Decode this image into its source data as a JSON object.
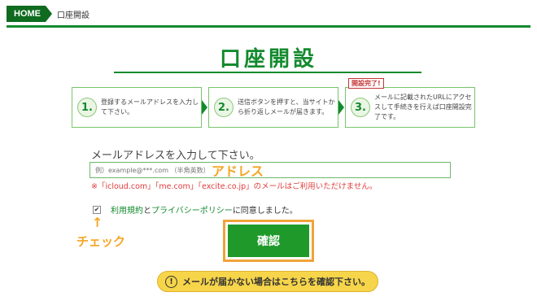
{
  "breadcrumb": {
    "home": "HOME",
    "current": "口座開設"
  },
  "page": {
    "title": "口座開設"
  },
  "steps": [
    {
      "num": "1.",
      "text": "登録するメールアドレスを入力して下さい。"
    },
    {
      "num": "2.",
      "text": "送信ボタンを押すと、当サイトから折り返しメールが届きます。"
    },
    {
      "num": "3.",
      "text": "メールに記載されたURLにアクセスして手続きを行えば口座開設完了です。"
    }
  ],
  "steps_badge": "開設完了!",
  "form": {
    "email_label": "メールアドレスを入力して下さい。",
    "email_placeholder": "例）example@***.com （半角英数）",
    "warning": "※「icloud.com」「me.com」「excite.co.jp」のメールはご利用いただけません。",
    "agree_link_terms": "利用規約",
    "agree_and": "と",
    "agree_link_privacy": "プライバシーポリシー",
    "agree_suffix": "に同意しました。",
    "confirm_label": "確認"
  },
  "annotations": {
    "address": "アドレス",
    "arrow": "↑",
    "check": "チェック"
  },
  "help": {
    "icon": "!",
    "label": "メールが届かない場合はこちらを確認下さい。"
  },
  "colors": {
    "brand_green": "#138a2e",
    "annotation_orange": "#f5a623",
    "warning_red": "#e03c3c",
    "help_yellow": "#f7d54a"
  }
}
